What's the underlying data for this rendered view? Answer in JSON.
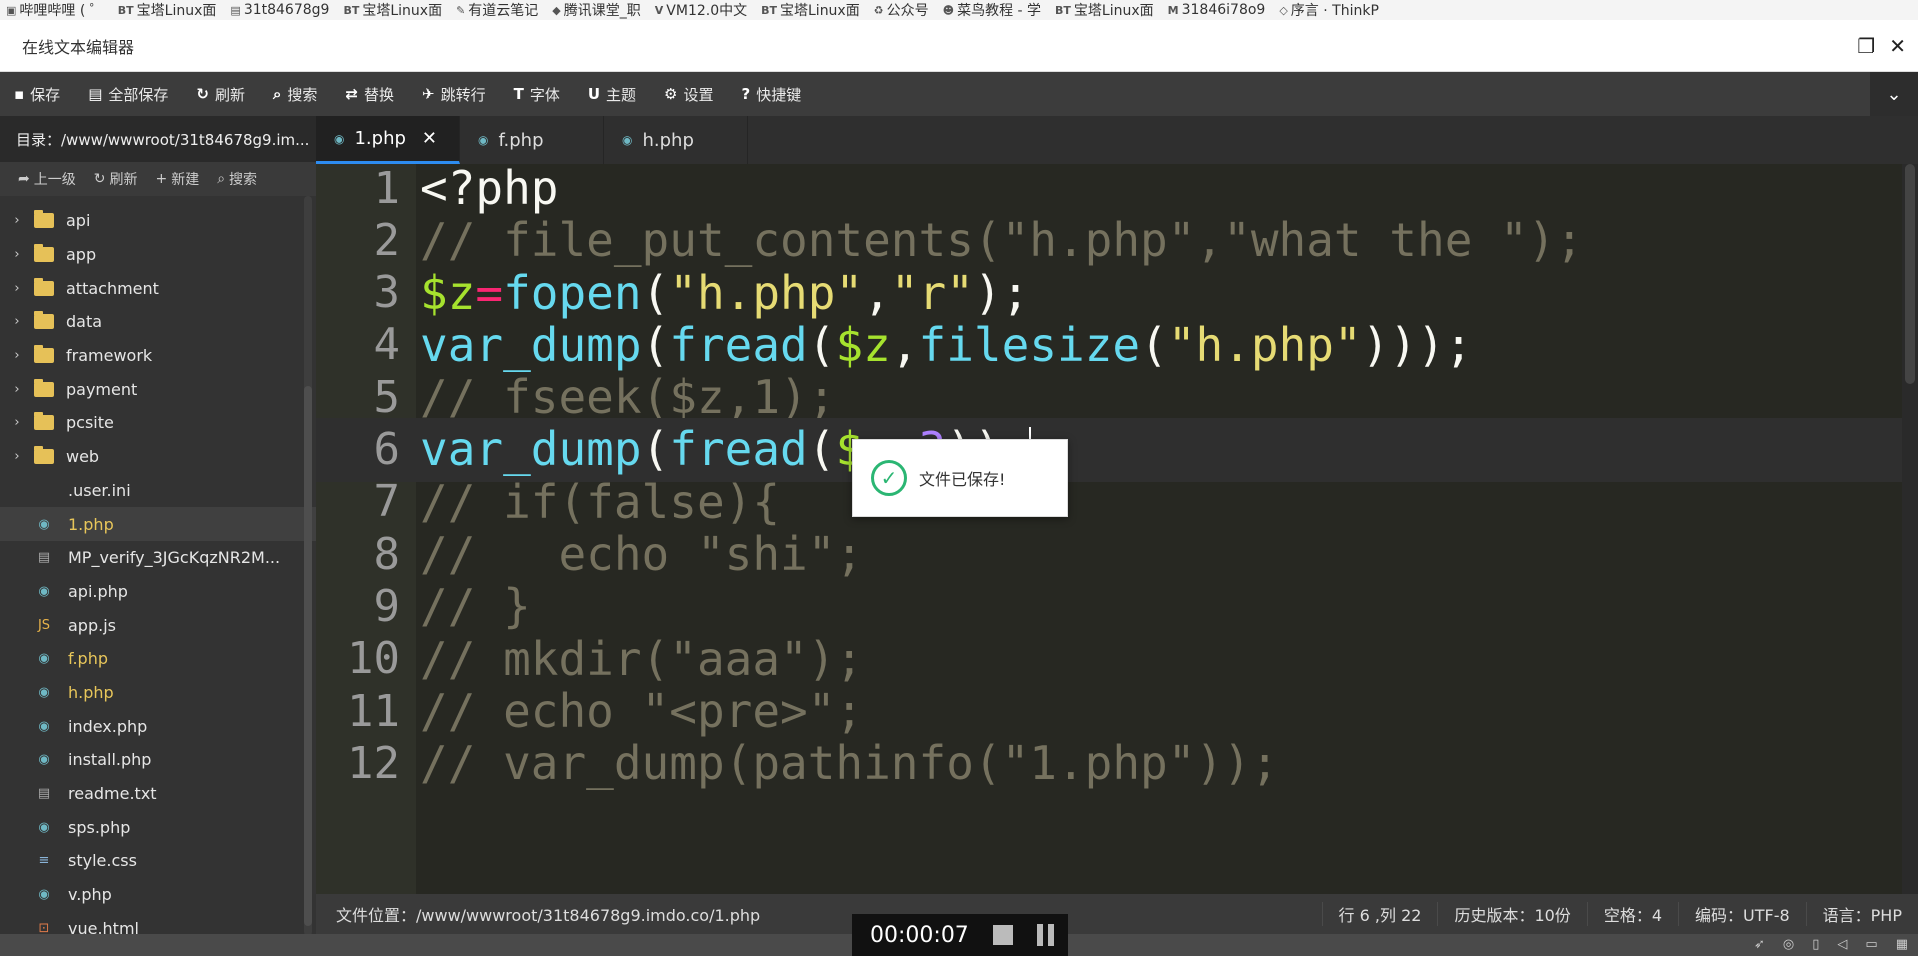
{
  "bookmarks": [
    {
      "icon": "bilibili-icon",
      "label": "哔哩哔哩 ( ゜"
    },
    {
      "icon": "bt-icon",
      "label": "宝塔Linux面"
    },
    {
      "icon": "doc-icon",
      "label": "31t84678g9"
    },
    {
      "icon": "bt-icon",
      "label": "宝塔Linux面"
    },
    {
      "icon": "note-icon",
      "label": "有道云笔记"
    },
    {
      "icon": "tencent-icon",
      "label": "腾讯课堂_职"
    },
    {
      "icon": "vm-icon",
      "label": "VM12.0中文"
    },
    {
      "icon": "bt-icon",
      "label": "宝塔Linux面"
    },
    {
      "icon": "wechat-icon",
      "label": "公众号"
    },
    {
      "icon": "runoob-icon",
      "label": "菜鸟教程 - 学"
    },
    {
      "icon": "bt-icon",
      "label": "宝塔Linux面"
    },
    {
      "icon": "m-icon",
      "label": "31846i78o9"
    },
    {
      "icon": "think-icon",
      "label": "序言 · ThinkP"
    }
  ],
  "window": {
    "title": "在线文本编辑器"
  },
  "toolbar": {
    "buttons": [
      {
        "icon": "save-icon",
        "label": "保存"
      },
      {
        "icon": "save-all-icon",
        "label": "全部保存"
      },
      {
        "icon": "refresh-icon",
        "label": "刷新"
      },
      {
        "icon": "search-icon",
        "label": "搜索"
      },
      {
        "icon": "replace-icon",
        "label": "替换"
      },
      {
        "icon": "goto-line-icon",
        "label": "跳转行"
      },
      {
        "icon": "font-icon",
        "label": "字体"
      },
      {
        "icon": "theme-icon",
        "label": "主题"
      },
      {
        "icon": "gear-icon",
        "label": "设置"
      },
      {
        "icon": "help-icon",
        "label": "快捷键"
      }
    ]
  },
  "sidebar": {
    "directory": "目录：/www/wwwroot/31t84678g9.im...",
    "tools": [
      {
        "icon": "up-icon",
        "label": "上一级"
      },
      {
        "icon": "refresh-icon",
        "label": "刷新"
      },
      {
        "icon": "plus-icon",
        "label": "新建"
      },
      {
        "icon": "search-icon",
        "label": "搜索"
      }
    ],
    "folders": [
      "api",
      "app",
      "attachment",
      "data",
      "framework",
      "payment",
      "pcsite",
      "web"
    ],
    "files": [
      {
        "name": ".user.ini",
        "type": "plain",
        "state": ""
      },
      {
        "name": "1.php",
        "type": "php",
        "state": "active-modified"
      },
      {
        "name": "MP_verify_3JGcKqzNR2M...",
        "type": "text",
        "state": ""
      },
      {
        "name": "api.php",
        "type": "php",
        "state": ""
      },
      {
        "name": "app.js",
        "type": "js",
        "state": ""
      },
      {
        "name": "f.php",
        "type": "php",
        "state": "modified"
      },
      {
        "name": "h.php",
        "type": "php",
        "state": "modified"
      },
      {
        "name": "index.php",
        "type": "php",
        "state": ""
      },
      {
        "name": "install.php",
        "type": "php",
        "state": ""
      },
      {
        "name": "readme.txt",
        "type": "text",
        "state": ""
      },
      {
        "name": "sps.php",
        "type": "php",
        "state": ""
      },
      {
        "name": "style.css",
        "type": "css",
        "state": ""
      },
      {
        "name": "v.php",
        "type": "php",
        "state": ""
      },
      {
        "name": "vue.html",
        "type": "html",
        "state": ""
      }
    ]
  },
  "tabs": [
    {
      "label": "1.php",
      "active": true
    },
    {
      "label": "f.php",
      "active": false
    },
    {
      "label": "h.php",
      "active": false
    }
  ],
  "editor": {
    "lines": [
      {
        "n": "1",
        "tokens": [
          [
            "plain",
            "<?php"
          ]
        ]
      },
      {
        "n": "2",
        "tokens": [
          [
            "cm",
            "// file_put_contents(\"h.php\",\"what the \");"
          ]
        ]
      },
      {
        "n": "3",
        "tokens": [
          [
            "var",
            "$z"
          ],
          [
            "op",
            "="
          ],
          [
            "fn",
            "fopen"
          ],
          [
            "plain",
            "("
          ],
          [
            "str",
            "\"h.php\""
          ],
          [
            "plain",
            ","
          ],
          [
            "str",
            "\"r\""
          ],
          [
            "plain",
            ");"
          ]
        ]
      },
      {
        "n": "4",
        "tokens": [
          [
            "fn",
            "var_dump"
          ],
          [
            "plain",
            "("
          ],
          [
            "fn",
            "fread"
          ],
          [
            "plain",
            "("
          ],
          [
            "var",
            "$z"
          ],
          [
            "plain",
            ","
          ],
          [
            "fn",
            "filesize"
          ],
          [
            "plain",
            "("
          ],
          [
            "str",
            "\"h.php\""
          ],
          [
            "plain",
            "))); "
          ]
        ]
      },
      {
        "n": "5",
        "tokens": [
          [
            "cm",
            "// fseek($z,1);"
          ]
        ]
      },
      {
        "n": "6",
        "tokens": [
          [
            "fn",
            "var_dump"
          ],
          [
            "plain",
            "("
          ],
          [
            "fn",
            "fread"
          ],
          [
            "plain",
            "("
          ],
          [
            "var",
            "$z"
          ],
          [
            "plain",
            ","
          ],
          [
            "num-lit",
            "3"
          ],
          [
            "plain",
            "));"
          ]
        ]
      },
      {
        "n": "7",
        "tokens": [
          [
            "cm",
            "// if(false){"
          ]
        ]
      },
      {
        "n": "8",
        "tokens": [
          [
            "cm",
            "//   echo \"shi\";"
          ]
        ]
      },
      {
        "n": "9",
        "tokens": [
          [
            "cm",
            "// }"
          ]
        ]
      },
      {
        "n": "10",
        "tokens": [
          [
            "cm",
            "// mkdir(\"aaa\");"
          ]
        ]
      },
      {
        "n": "11",
        "tokens": [
          [
            "cm",
            "// echo \"<pre>\";"
          ]
        ]
      },
      {
        "n": "12",
        "tokens": [
          [
            "cm",
            "// var_dump(pathinfo(\"1.php\"));"
          ]
        ]
      }
    ]
  },
  "toast": {
    "message": "文件已保存!"
  },
  "status": {
    "path": "文件位置：/www/wwwroot/31t84678g9.imdo.co/1.php",
    "position": "行 6 ,列 22",
    "history": "历史版本：10份",
    "spaces": "空格：4",
    "encoding": "编码：UTF-8",
    "language": "语言：PHP"
  },
  "recorder": {
    "time": "00:00:07"
  },
  "colors": {
    "accent": "#2d8cf0",
    "modified": "#e8c65a",
    "success": "#2bb673"
  }
}
